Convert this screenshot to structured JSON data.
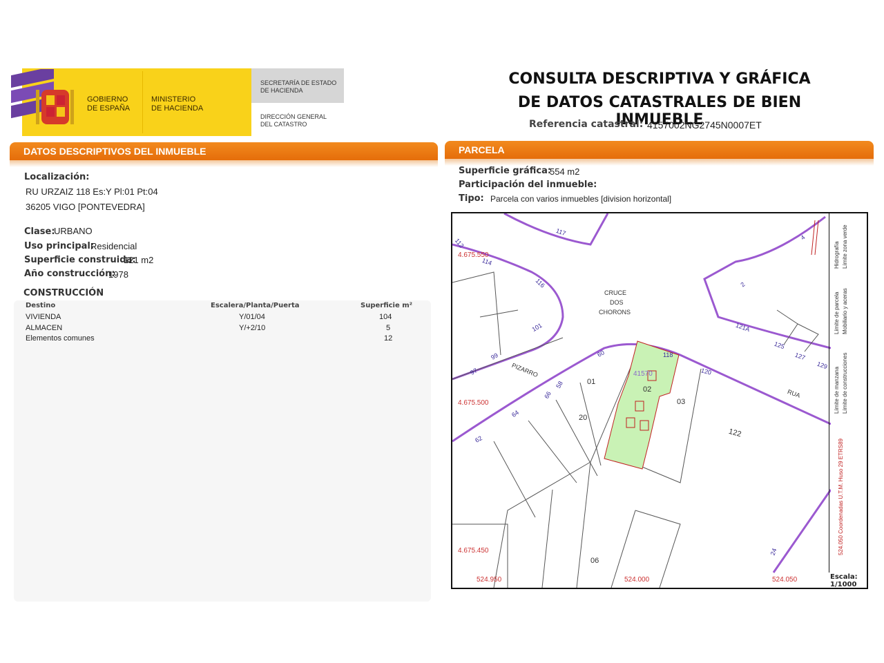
{
  "header": {
    "gov_line1": "GOBIERNO",
    "gov_line2": "DE ESPAÑA",
    "ministry_line1": "MINISTERIO",
    "ministry_line2": "DE HACIENDA",
    "secretaria_line1": "SECRETARÍA DE ESTADO",
    "secretaria_line2": "DE HACIENDA",
    "direccion_line1": "DIRECCIÓN GENERAL",
    "direccion_line2": "DEL CATASTRO",
    "title_line1": "CONSULTA DESCRIPTIVA Y GRÁFICA",
    "title_line2": "DE DATOS CATASTRALES DE BIEN INMUEBLE",
    "ref_label": "Referencia catastral:",
    "ref_value": "4157002NG2745N0007ET"
  },
  "datos": {
    "section_title": "DATOS DESCRIPTIVOS DEL INMUEBLE",
    "localizacion_label": "Localización:",
    "address_line1": "RU URZAIZ 118 Es:Y Pl:01 Pt:04",
    "address_line2": "36205 VIGO [PONTEVEDRA]",
    "clase_label": "Clase:",
    "clase_value": "URBANO",
    "uso_label": "Uso principal:",
    "uso_value": "Residencial",
    "superficie_label": "Superficie construida:",
    "superficie_value": "121 m2",
    "anio_label": "Año construcción:",
    "anio_value": "1978",
    "construccion_title": "CONSTRUCCIÓN",
    "table_headers": [
      "Destino",
      "Escalera/Planta/Puerta",
      "Superficie m²"
    ],
    "rows": [
      {
        "destino": "VIVIENDA",
        "planta": "Y/01/04",
        "superficie": "104"
      },
      {
        "destino": "ALMACEN",
        "planta": "Y/+2/10",
        "superficie": "5"
      },
      {
        "destino": "Elementos comunes",
        "planta": "",
        "superficie": "12"
      }
    ]
  },
  "parcela": {
    "section_title": "PARCELA",
    "superficie_label": "Superficie gráfica:",
    "superficie_value": "554 m2",
    "participacion_label": "Participación del inmueble:",
    "tipo_label": "Tipo:",
    "tipo_value": "Parcela con varios inmuebles [division horizontal]"
  },
  "map": {
    "cruce_line1": "CRUCE",
    "cruce_line2": "DOS",
    "cruce_line3": "CHORONS",
    "street_pizarro": "PIZARRO",
    "street_rua": "RUA",
    "coord_y1": "4.675.550",
    "coord_y2": "4.675.500",
    "coord_y3": "4.675.450",
    "coord_x1": "524.950",
    "coord_x2": "524.000",
    "coord_x3": "524.050",
    "parcel_id": "41570",
    "parcel_numbers": [
      "01",
      "02",
      "03",
      "20",
      "122",
      "06"
    ],
    "street_numbers": [
      "117",
      "112",
      "114",
      "116",
      "101",
      "99",
      "97",
      "60",
      "58",
      "66",
      "64",
      "62",
      "118",
      "120",
      "2",
      "4",
      "121A",
      "125",
      "127",
      "129",
      "24"
    ],
    "legend": [
      "Límite de manzana",
      "Límite de construcciones",
      "Límite de parcela",
      "Mobiliario y aceras",
      "Hidrografía",
      "Límite zona verde"
    ],
    "coord_note": "524.050 Coordenadas U.T.M. Huso 29 ETRS89",
    "escala_label": "Escala:",
    "escala_value": "1/1000",
    "colors": {
      "street": "#9b59d0",
      "parcel_fill": "#c9f2b5",
      "parcel_edge": "#c02020"
    }
  }
}
